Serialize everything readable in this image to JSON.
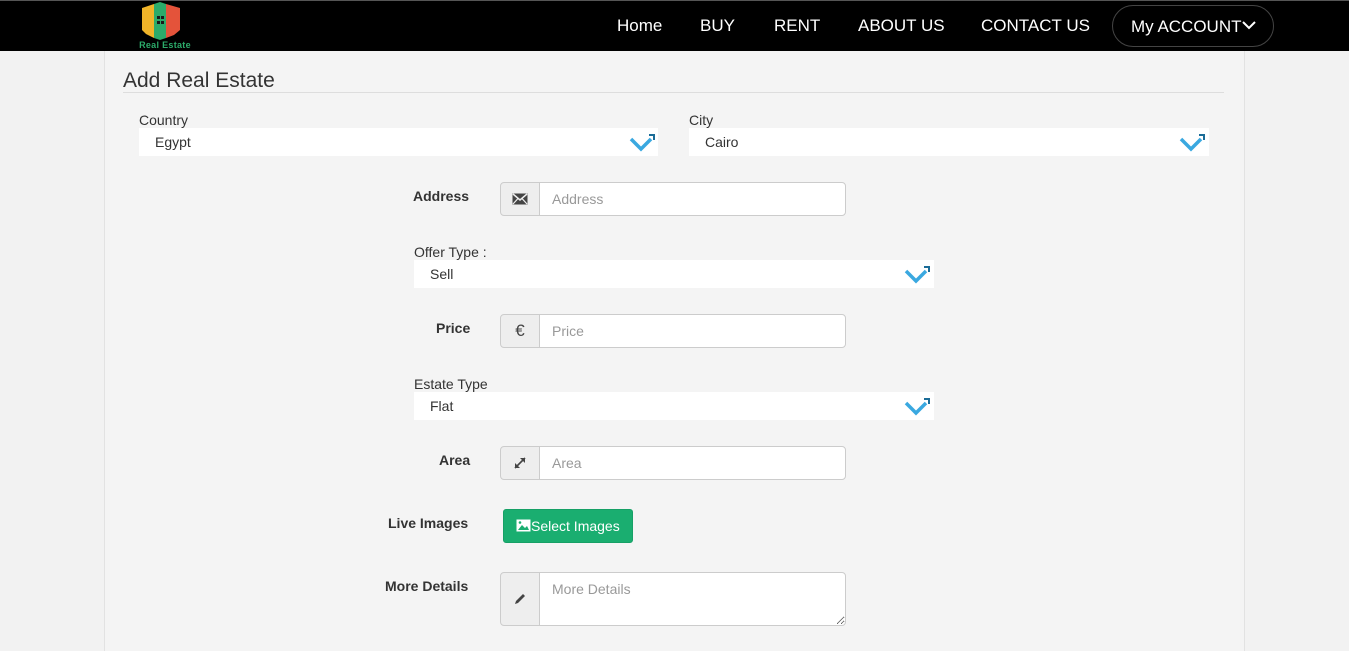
{
  "brand": {
    "logo_text": "Real Estate",
    "colors": {
      "green": "#2cab6a",
      "yellow": "#f0b429",
      "red": "#e4533a"
    }
  },
  "nav": {
    "items": [
      {
        "label": "Home"
      },
      {
        "label": "BUY"
      },
      {
        "label": "RENT"
      },
      {
        "label": "ABOUT US"
      },
      {
        "label": "CONTACT US"
      }
    ],
    "account_label": "My ACCOUNT",
    "account_icon": "chevron-down-icon"
  },
  "form": {
    "title": "Add Real Estate",
    "country": {
      "label": "Country",
      "value": "Egypt"
    },
    "city": {
      "label": "City",
      "value": "Cairo"
    },
    "address": {
      "label": "Address",
      "placeholder": "Address",
      "icon": "envelope-icon"
    },
    "offer_type": {
      "label": "Offer Type :",
      "value": "Sell"
    },
    "price": {
      "label": "Price",
      "placeholder": "Price",
      "icon": "euro-icon",
      "icon_glyph": "€"
    },
    "estate_type": {
      "label": "Estate Type",
      "value": "Flat"
    },
    "area": {
      "label": "Area",
      "placeholder": "Area",
      "icon": "resize-icon"
    },
    "live_images": {
      "label": "Live Images",
      "button_label": "Select Images",
      "icon": "picture-icon",
      "button_color": "#1aae70"
    },
    "more_details": {
      "label": "More Details",
      "placeholder": "More Details",
      "icon": "pencil-icon"
    }
  },
  "colors": {
    "select_arrow": "#3aa8e0",
    "navbar": "#000000"
  }
}
